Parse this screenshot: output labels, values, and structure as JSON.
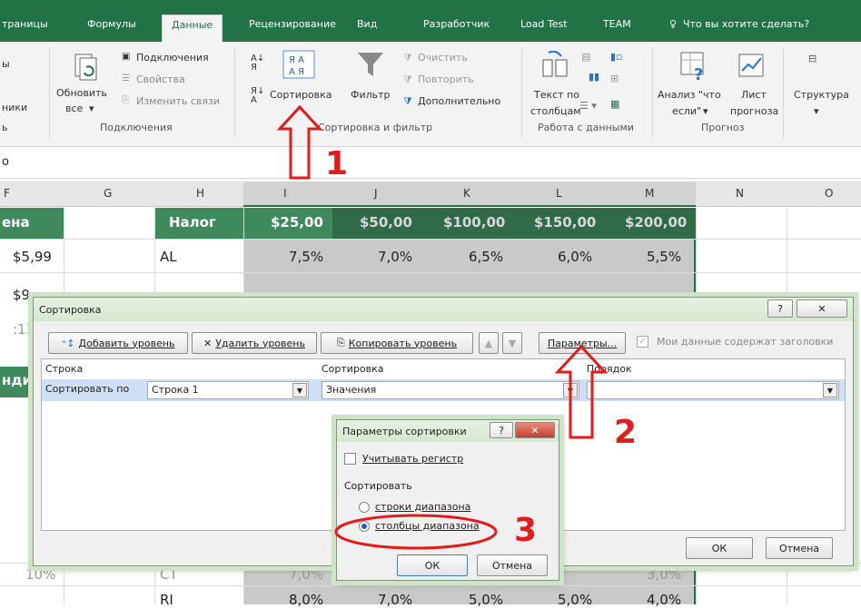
{
  "ribbon_tabs": [
    "траницы",
    "Формулы",
    "Данные",
    "Рецензирование",
    "Вид",
    "Разработчик",
    "Load Test",
    "TEAM",
    "Что вы хотите сделать?"
  ],
  "ribbon": {
    "left_partial_1": "ы",
    "left_partial_2": "ники",
    "left_partial_3": "ь",
    "refresh_label_1": "Обновить",
    "refresh_label_2": "все",
    "connections": "Подключения",
    "properties": "Свойства",
    "edit_links": "Изменить связи",
    "sort_label": "Сортировка",
    "filter_label": "Фильтр",
    "clear": "Очистить",
    "reapply": "Повторить",
    "advanced": "Дополнительно",
    "text_to_cols_1": "Текст по",
    "text_to_cols_2": "столбцам",
    "whatif_1": "Анализ \"что",
    "whatif_2": "если\"",
    "forecast_1": "Лист",
    "forecast_2": "прогноза",
    "structure": "Структура",
    "group_connections": "Подключения",
    "group_sort": "Сортировка и фильтр",
    "group_data_tools": "Работа с данными",
    "group_forecast": "Прогноз"
  },
  "formula_bar_text": "o",
  "columns": [
    "F",
    "G",
    "H",
    "I",
    "J",
    "K",
    "L",
    "M",
    "N",
    "O"
  ],
  "sheet": {
    "header_row": {
      "f": "ена",
      "h": "Налог",
      "vals": [
        "$25,00",
        "$50,00",
        "$100,00",
        "$150,00",
        "$200,00"
      ]
    },
    "row_al": {
      "f": "$5,99",
      "h": "AL",
      "vals": [
        "7,5%",
        "7,0%",
        "6,5%",
        "6,0%",
        "5,5%"
      ]
    },
    "row2_f": "$9",
    "row3_f": ":13",
    "row4_f": "нди",
    "row_ct": {
      "f": "10%",
      "h": "CT",
      "vals": [
        "7,0%",
        "",
        "",
        "",
        "3,0%"
      ]
    },
    "row_ri": {
      "h": "RI",
      "vals": [
        "8,0%",
        "7,0%",
        "5,0%",
        "5,0%",
        "4,0%"
      ]
    }
  },
  "sort_dialog": {
    "title": "Сортировка",
    "help": "?",
    "close": "✕",
    "add_level": "Добавить уровень",
    "delete_level": "Удалить уровень",
    "copy_level": "Копировать уровень",
    "options": "Параметры...",
    "has_headers": "Мои данные содержат заголовки",
    "col_row": "Строка",
    "col_sort": "Сортировка",
    "col_order": "Порядок",
    "sort_by": "Сортировать по",
    "row_value": "Строка 1",
    "sort_on_value": "Значения",
    "order_value": "",
    "ok": "ОК",
    "cancel": "Отмена"
  },
  "options_dialog": {
    "title": "Параметры сортировки",
    "case_sensitive": "Учитывать регистр",
    "orientation": "Сортировать",
    "rows_option": "строки диапазона",
    "cols_option": "столбцы диапазона",
    "ok": "ОК",
    "cancel": "Отмена"
  },
  "annotations": {
    "one": "1",
    "two": "2",
    "three": "3"
  },
  "colors": {
    "excel_green": "#217346",
    "header_green": "#3f8a5c",
    "gray_cell": "#c9c9c9",
    "annotation_red": "#e21b1b"
  }
}
